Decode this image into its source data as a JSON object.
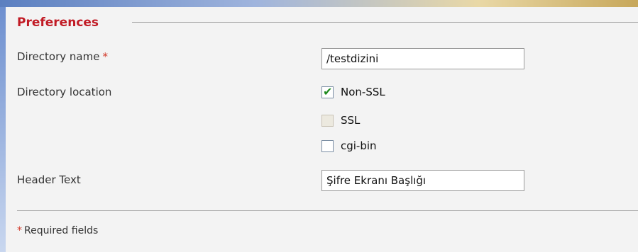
{
  "section": {
    "legend": "Preferences"
  },
  "fields": {
    "directory_name": {
      "label": "Directory name",
      "required_mark": "*",
      "value": "/testdizini"
    },
    "directory_location": {
      "label": "Directory location",
      "options": [
        {
          "label": "Non-SSL",
          "checked": true,
          "disabled": false
        },
        {
          "label": "SSL",
          "checked": false,
          "disabled": true
        },
        {
          "label": "cgi-bin",
          "checked": false,
          "disabled": false
        }
      ]
    },
    "header_text": {
      "label": "Header Text",
      "value": "Şifre Ekranı Başlığı"
    }
  },
  "footer": {
    "required_mark": "*",
    "required_note": "Required fields"
  },
  "colors": {
    "legend": "#c11a24",
    "required": "#d23a2a",
    "checkmark": "#1f8a1f",
    "panel_bg": "#f3f3f3"
  }
}
